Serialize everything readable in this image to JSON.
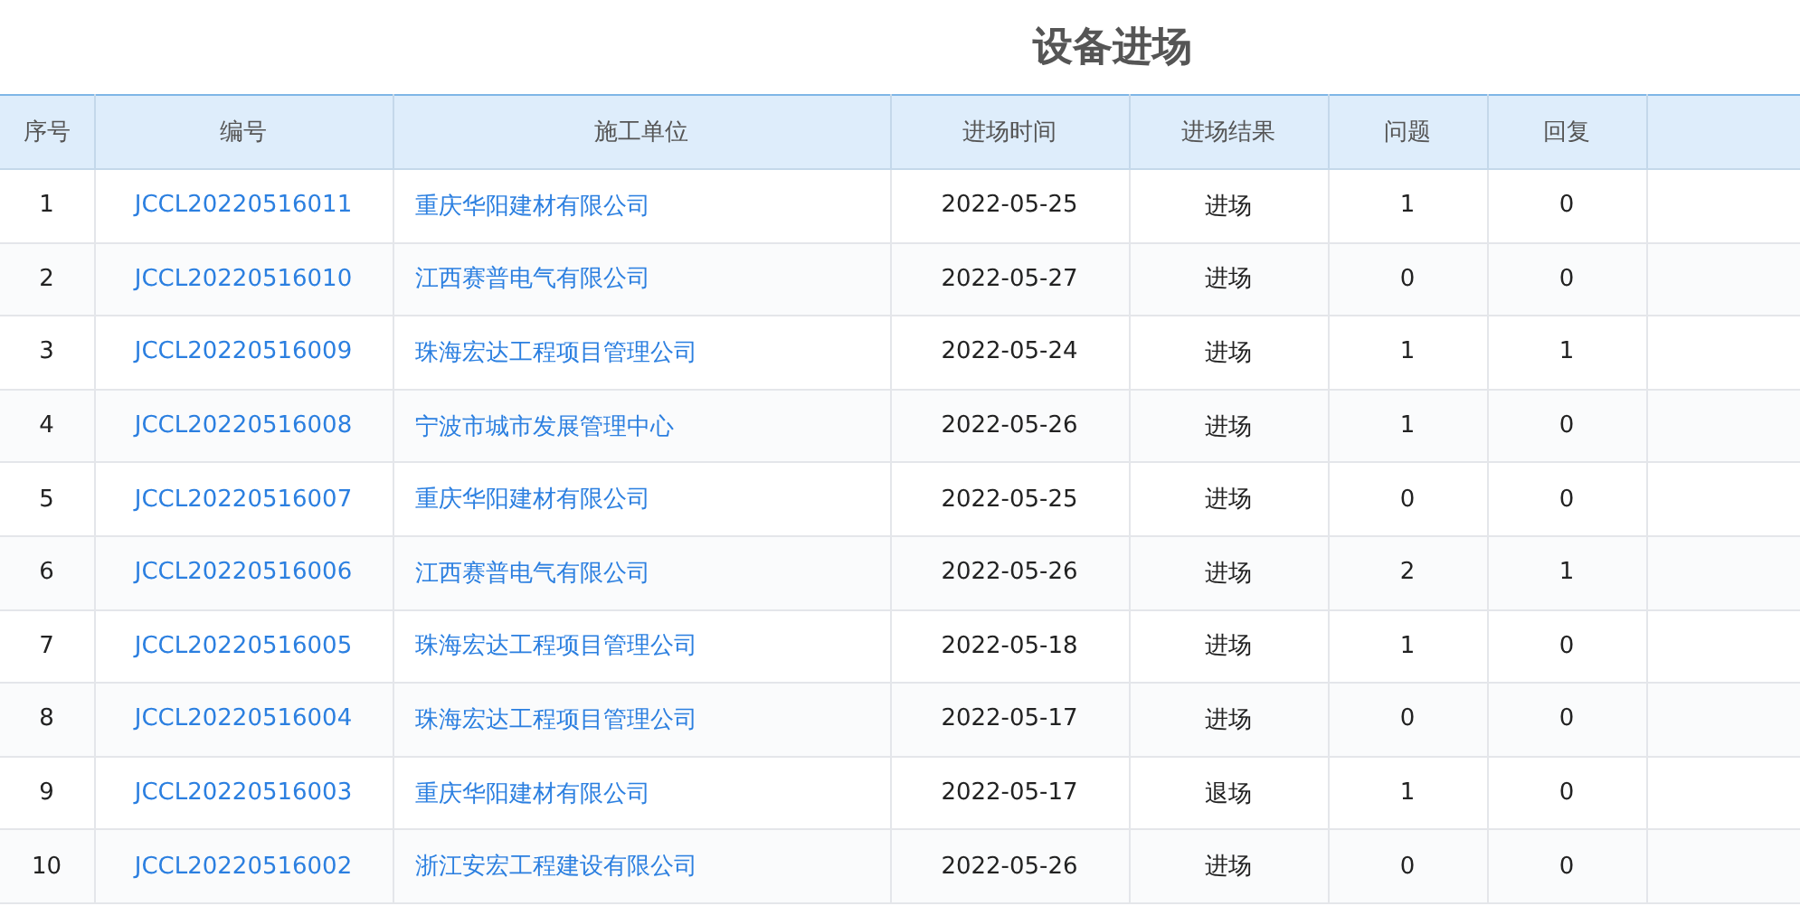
{
  "title": "设备进场",
  "table": {
    "columns": [
      "序号",
      "编号",
      "施工单位",
      "进场时间",
      "进场结果",
      "问题",
      "回复"
    ],
    "rows": [
      {
        "no": "1",
        "code": "JCCL20220516011",
        "unit": "重庆华阳建材有限公司",
        "time": "2022-05-25",
        "result": "进场",
        "issues": "1",
        "replies": "0"
      },
      {
        "no": "2",
        "code": "JCCL20220516010",
        "unit": "江西赛普电气有限公司",
        "time": "2022-05-27",
        "result": "进场",
        "issues": "0",
        "replies": "0"
      },
      {
        "no": "3",
        "code": "JCCL20220516009",
        "unit": "珠海宏达工程项目管理公司",
        "time": "2022-05-24",
        "result": "进场",
        "issues": "1",
        "replies": "1"
      },
      {
        "no": "4",
        "code": "JCCL20220516008",
        "unit": "宁波市城市发展管理中心",
        "time": "2022-05-26",
        "result": "进场",
        "issues": "1",
        "replies": "0"
      },
      {
        "no": "5",
        "code": "JCCL20220516007",
        "unit": "重庆华阳建材有限公司",
        "time": "2022-05-25",
        "result": "进场",
        "issues": "0",
        "replies": "0"
      },
      {
        "no": "6",
        "code": "JCCL20220516006",
        "unit": "江西赛普电气有限公司",
        "time": "2022-05-26",
        "result": "进场",
        "issues": "2",
        "replies": "1"
      },
      {
        "no": "7",
        "code": "JCCL20220516005",
        "unit": "珠海宏达工程项目管理公司",
        "time": "2022-05-18",
        "result": "进场",
        "issues": "1",
        "replies": "0"
      },
      {
        "no": "8",
        "code": "JCCL20220516004",
        "unit": "珠海宏达工程项目管理公司",
        "time": "2022-05-17",
        "result": "进场",
        "issues": "0",
        "replies": "0"
      },
      {
        "no": "9",
        "code": "JCCL20220516003",
        "unit": "重庆华阳建材有限公司",
        "time": "2022-05-17",
        "result": "退场",
        "issues": "1",
        "replies": "0"
      },
      {
        "no": "10",
        "code": "JCCL20220516002",
        "unit": "浙江安宏工程建设有限公司",
        "time": "2022-05-26",
        "result": "进场",
        "issues": "0",
        "replies": "0"
      }
    ]
  }
}
